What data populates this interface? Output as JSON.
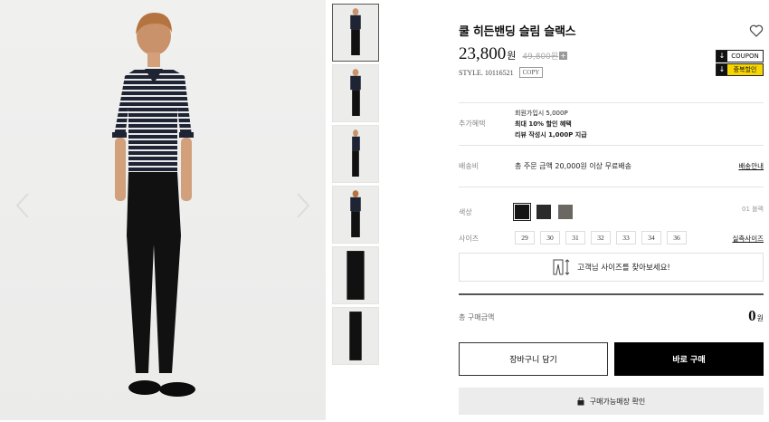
{
  "product": {
    "title": "쿨 히든밴딩 슬림 슬랙스",
    "price": "23,800",
    "price_unit": "원",
    "original_price": "49,800원",
    "plus_icon": "+",
    "style_label": "STYLE. 10116521",
    "copy_label": "COPY"
  },
  "coupons": [
    {
      "icon": "download-icon",
      "label": "COUPON"
    },
    {
      "icon": "download-icon",
      "label": "중복할인"
    }
  ],
  "benefits": {
    "label": "추가혜택",
    "lines": [
      "회원가입시 5,000P",
      "최대 10% 할인 혜택",
      "리뷰 작성시 1,000P 지급"
    ]
  },
  "shipping": {
    "label": "배송비",
    "text": "총 주문 금액 20,000원 이상 무료배송",
    "link": "배송안내"
  },
  "color": {
    "label": "색상",
    "selected_name": "01 블랙",
    "swatches": [
      "#141414",
      "#2b2b2b",
      "#6b6864"
    ]
  },
  "size": {
    "label": "사이즈",
    "options": [
      "29",
      "30",
      "31",
      "32",
      "33",
      "34",
      "36"
    ],
    "guide_link": "실측사이즈",
    "find_label": "고객님 사이즈를 찾아보세요!"
  },
  "total": {
    "label": "총 구매금액",
    "value": "0",
    "unit": "원"
  },
  "actions": {
    "cart": "장바구니 담기",
    "buy": "바로 구매",
    "store": "구매가능매장 확인"
  },
  "colors": {
    "accent_yellow": "#f7d500",
    "buy_button": "#000000",
    "store_button": "#ececec"
  }
}
